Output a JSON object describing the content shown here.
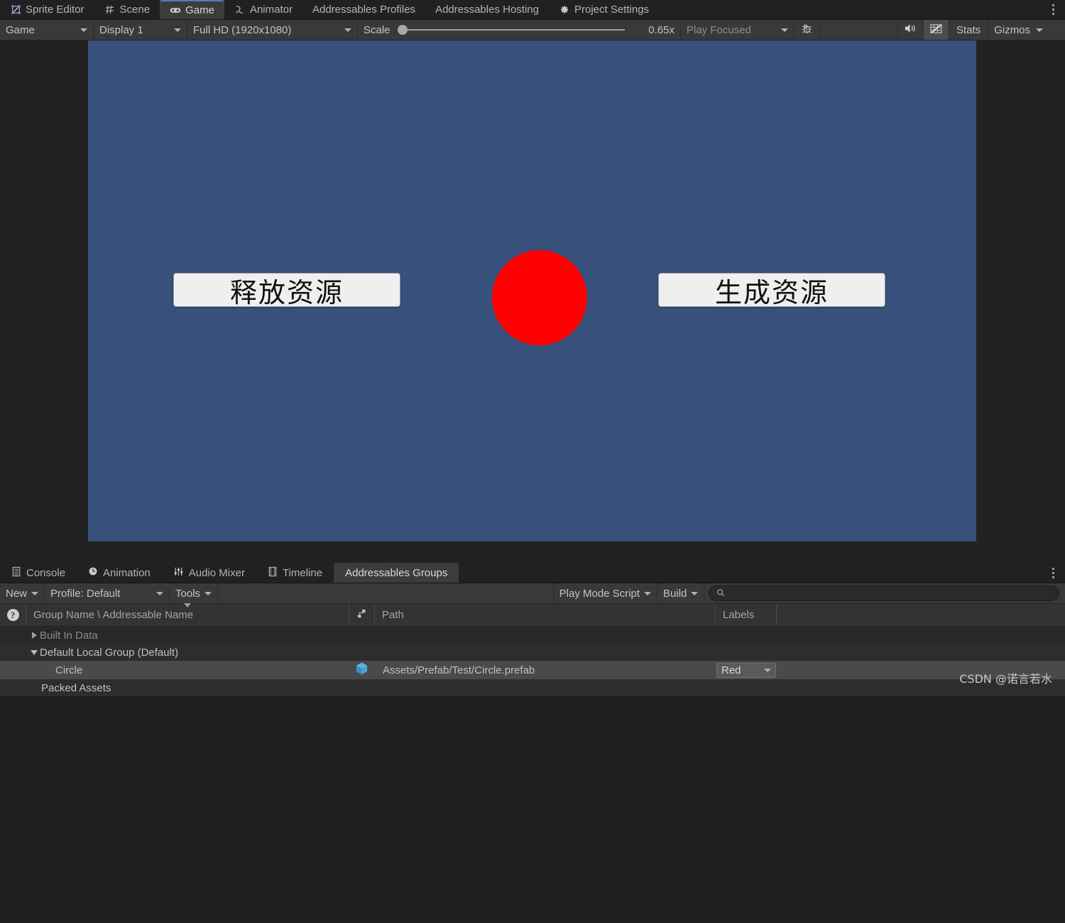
{
  "top_tabs": [
    {
      "label": "Sprite Editor",
      "icon": "sprite-editor-icon",
      "active": false
    },
    {
      "label": "Scene",
      "icon": "scene-grid-icon",
      "active": false
    },
    {
      "label": "Game",
      "icon": "gamepad-icon",
      "active": true
    },
    {
      "label": "Animator",
      "icon": "animator-icon",
      "active": false
    },
    {
      "label": "Addressables Profiles",
      "icon": "",
      "active": false
    },
    {
      "label": "Addressables Hosting",
      "icon": "",
      "active": false
    },
    {
      "label": "Project Settings",
      "icon": "gear-icon",
      "active": false
    }
  ],
  "game_toolbar": {
    "view_mode": "Game",
    "display": "Display 1",
    "aspect": "Full HD (1920x1080)",
    "scale_label": "Scale",
    "scale_value": "0.65x",
    "scale_fraction": 0.02,
    "play_focus": "Play Focused",
    "mute_icon": "speaker-icon",
    "debug_icon": "bug-icon",
    "gizmos_grid_icon": "gizmos-toggle-icon",
    "stats_label": "Stats",
    "gizmos_label": "Gizmos"
  },
  "game_view": {
    "background_color": "#38507c",
    "letterbox_color": "#222222",
    "release_button": "释放资源",
    "spawn_button": "生成资源",
    "circle_color": "#ff0000"
  },
  "bottom_tabs": [
    {
      "label": "Console",
      "icon": "console-icon",
      "active": false
    },
    {
      "label": "Animation",
      "icon": "animation-clock-icon",
      "active": false
    },
    {
      "label": "Audio Mixer",
      "icon": "audio-mixer-icon",
      "active": false
    },
    {
      "label": "Timeline",
      "icon": "timeline-icon",
      "active": false
    },
    {
      "label": "Addressables Groups",
      "icon": "",
      "active": true
    }
  ],
  "addressables_toolbar": {
    "new_label": "New",
    "profile_label": "Profile: Default",
    "tools_label": "Tools",
    "play_mode_script_label": "Play Mode Script",
    "build_label": "Build",
    "search_placeholder": "",
    "search_value": "",
    "search_icon": "search-icon"
  },
  "table": {
    "help_icon": "help-icon",
    "columns": [
      {
        "key": "name",
        "label": "Group Name \\ Addressable Name",
        "sorted": true
      },
      {
        "key": "type",
        "label": ""
      },
      {
        "key": "path",
        "label": "Path"
      },
      {
        "key": "labels",
        "label": "Labels"
      }
    ],
    "rows": [
      {
        "name": "Built In Data",
        "indent": 1,
        "twisty": "collapsed",
        "dim": true,
        "selected": false,
        "alt": false,
        "path": "",
        "label": "",
        "icon": ""
      },
      {
        "name": "Default Local Group (Default)",
        "indent": 1,
        "twisty": "expanded",
        "dim": false,
        "selected": false,
        "alt": true,
        "path": "",
        "label": "",
        "icon": ""
      },
      {
        "name": "Circle",
        "indent": 2,
        "twisty": "none",
        "dim": false,
        "selected": true,
        "alt": false,
        "path": "Assets/Prefab/Test/Circle.prefab",
        "label": "Red",
        "icon": "prefab-cube-icon"
      },
      {
        "name": "Packed Assets",
        "indent": 1,
        "twisty": "none",
        "dim": false,
        "selected": false,
        "alt": true,
        "path": "",
        "label": "",
        "icon": ""
      }
    ]
  },
  "watermark": "CSDN @诺言若水"
}
